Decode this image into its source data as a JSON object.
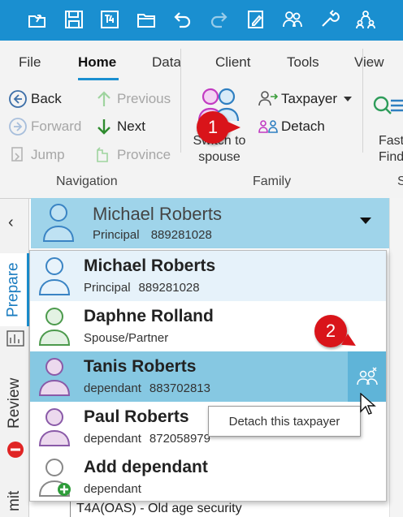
{
  "quick_access": {
    "icons": [
      "open-folder-arrow-icon",
      "save-icon",
      "t4-slip-icon",
      "folder-icon",
      "undo-icon",
      "redo-icon",
      "edit-form-icon",
      "family-icon",
      "tools-icon",
      "family-tree-icon"
    ]
  },
  "ribbon": {
    "tabs": [
      "File",
      "Home",
      "Data",
      "Client",
      "Tools",
      "View"
    ],
    "active_tab": "Home",
    "navigation": {
      "back": "Back",
      "previous": "Previous",
      "forward": "Forward",
      "next": "Next",
      "jump": "Jump",
      "province": "Province",
      "group_label": "Navigation"
    },
    "family": {
      "switch_line1": "Switch to",
      "switch_line2": "spouse",
      "taxpayer": "Taxpayer",
      "detach": "Detach",
      "group_label": "Family"
    },
    "fast_find": {
      "line1": "Fast",
      "line2": "Find",
      "group_label_partial": "S"
    }
  },
  "callouts": {
    "one": "1",
    "two": "2"
  },
  "leftnav": {
    "collapse_glyph": "‹",
    "prepare": "Prepare",
    "review": "Review",
    "submit": "mit"
  },
  "header": {
    "name": "Michael Roberts",
    "role": "Principal",
    "ssn": "889281028"
  },
  "dropdown": {
    "items": [
      {
        "name": "Michael Roberts",
        "role": "Principal",
        "ssn": "889281028"
      },
      {
        "name": "Daphne Rolland",
        "role": "Spouse/Partner",
        "ssn": ""
      },
      {
        "name": "Tanis Roberts",
        "role": "dependant",
        "ssn": "883702813"
      },
      {
        "name": "Paul Roberts",
        "role": "dependant",
        "ssn": "872058979"
      },
      {
        "name": "Add dependant",
        "role": "dependant",
        "ssn": ""
      }
    ]
  },
  "tooltip": "Detach this taxpayer",
  "behind_row": "T4A(OAS) - Old age security",
  "colors": {
    "accent": "#1a8fd0",
    "header_bg": "#9fd4ea",
    "selected_row": "#86c8e2",
    "callout": "#d9141a"
  }
}
